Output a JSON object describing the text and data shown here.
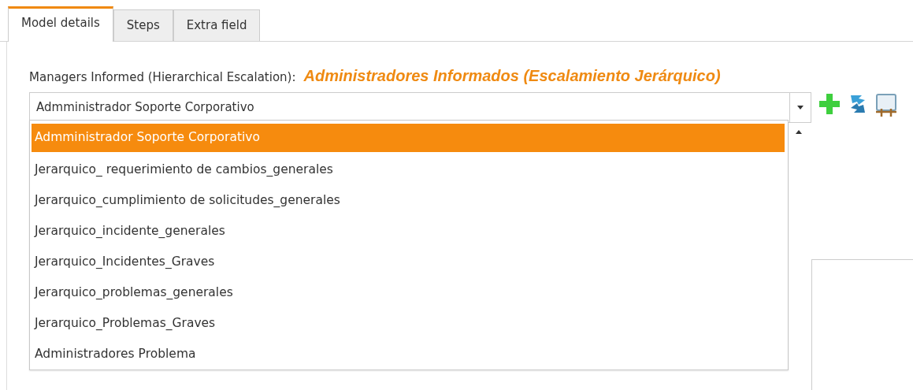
{
  "tabs": [
    {
      "label": "Model details",
      "selected": true
    },
    {
      "label": "Steps",
      "selected": false
    },
    {
      "label": "Extra field",
      "selected": false
    }
  ],
  "field": {
    "label": "Managers Informed (Hierarchical Escalation):",
    "annotation": "Administradores Informados (Escalamiento Jerárquico)",
    "value": "Admministrador Soporte Corporativo"
  },
  "dropdown": {
    "options": [
      {
        "label": "Admministrador Soporte Corporativo",
        "selected": true
      },
      {
        "label": "Jerarquico_ requerimiento de cambios_generales",
        "selected": false
      },
      {
        "label": "Jerarquico_cumplimiento de solicitudes_generales",
        "selected": false
      },
      {
        "label": "Jerarquico_incidente_generales",
        "selected": false
      },
      {
        "label": "Jerarquico_Incidentes_Graves",
        "selected": false
      },
      {
        "label": "Jerarquico_problemas_generales",
        "selected": false
      },
      {
        "label": "Jerarquico_Problemas_Graves",
        "selected": false
      },
      {
        "label": "Administradores Problema",
        "selected": false
      }
    ]
  }
}
